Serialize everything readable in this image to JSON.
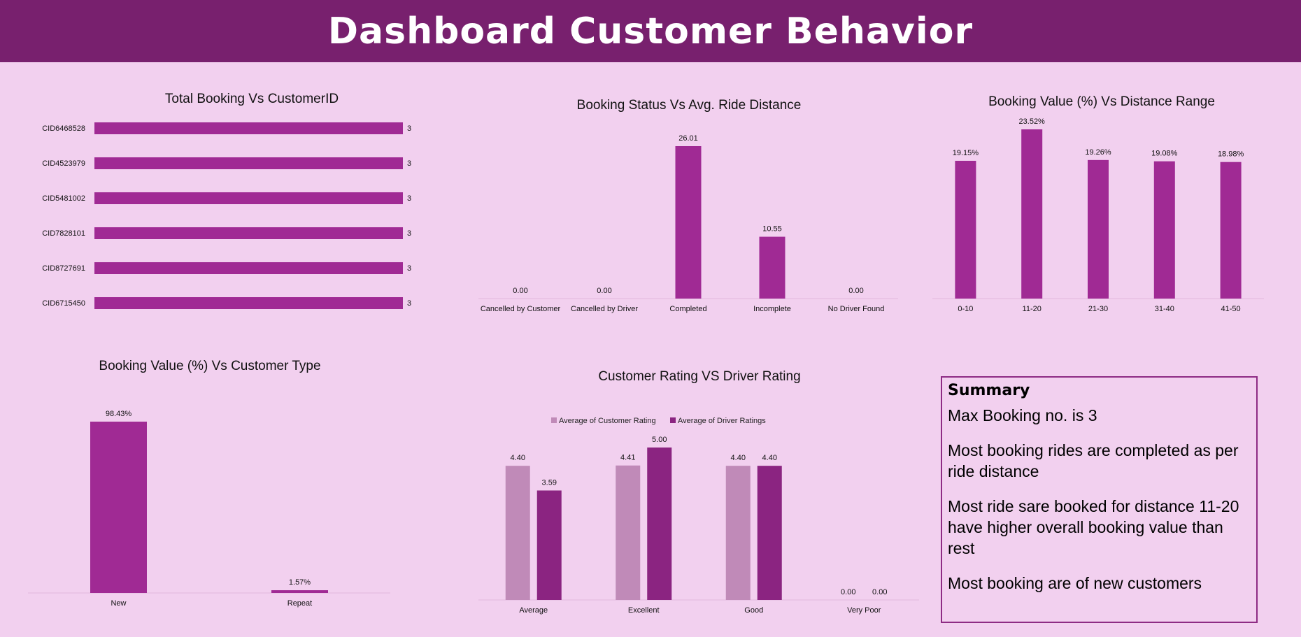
{
  "header": {
    "title": "Dashboard Customer Behavior"
  },
  "colors": {
    "bar": "#a02a94",
    "bar_light": "#c08ab8",
    "bar_dark": "#8b2481",
    "header": "#78206e",
    "background": "#f2d0ef"
  },
  "chart_data": [
    {
      "id": "c1",
      "type": "bar",
      "orientation": "horizontal",
      "title": "Total Booking Vs CustomerID",
      "categories": [
        "CID6468528",
        "CID4523979",
        "CID5481002",
        "CID7828101",
        "CID8727691",
        "CID6715450"
      ],
      "values": [
        3,
        3,
        3,
        3,
        3,
        3
      ],
      "labels": [
        "3",
        "3",
        "3",
        "3",
        "3",
        "3"
      ],
      "xlim": [
        0,
        3
      ]
    },
    {
      "id": "c2",
      "type": "bar",
      "title": "Booking Status Vs  Avg. Ride Distance",
      "categories": [
        "Cancelled by Customer",
        "Cancelled by Driver",
        "Completed",
        "Incomplete",
        "No Driver Found"
      ],
      "values": [
        0,
        0,
        26.01,
        10.55,
        0
      ],
      "labels": [
        "0.00",
        "0.00",
        "26.01",
        "10.55",
        "0.00"
      ],
      "ylim": [
        0,
        26.01
      ]
    },
    {
      "id": "c3",
      "type": "bar",
      "title": "Booking Value (%) Vs Distance Range",
      "categories": [
        "0-10",
        "11-20",
        "21-30",
        "31-40",
        "41-50"
      ],
      "values": [
        19.15,
        23.52,
        19.26,
        19.08,
        18.98
      ],
      "labels": [
        "19.15%",
        "23.52%",
        "19.26%",
        "19.08%",
        "18.98%"
      ],
      "ylim": [
        0,
        23.52
      ]
    },
    {
      "id": "c4",
      "type": "bar",
      "title": "Booking Value (%) Vs Customer Type",
      "categories": [
        "New",
        "Repeat"
      ],
      "values": [
        98.43,
        1.57
      ],
      "labels": [
        "98.43%",
        "1.57%"
      ],
      "ylim": [
        0,
        98.43
      ]
    },
    {
      "id": "c5",
      "type": "bar",
      "title": "Customer Rating VS Driver Rating",
      "categories": [
        "Average",
        "Excellent",
        "Good",
        "Very Poor"
      ],
      "series": [
        {
          "name": "Average of Customer Rating",
          "values": [
            4.4,
            4.41,
            4.4,
            0
          ],
          "labels": [
            "4.40",
            "4.41",
            "4.40",
            "0.00"
          ]
        },
        {
          "name": "Average of Driver Ratings",
          "values": [
            3.59,
            5.0,
            4.4,
            0
          ],
          "labels": [
            "3.59",
            "5.00",
            "4.40",
            "0.00"
          ]
        }
      ],
      "legend": "top",
      "ylim": [
        0,
        5
      ]
    }
  ],
  "summary": {
    "title": "Summary",
    "lines": [
      "Max Booking no. is  3",
      "Most booking rides are completed as per ride distance",
      "Most ride sare booked for distance 11-20 have higher overall booking value than rest",
      "Most booking are of new customers"
    ]
  }
}
